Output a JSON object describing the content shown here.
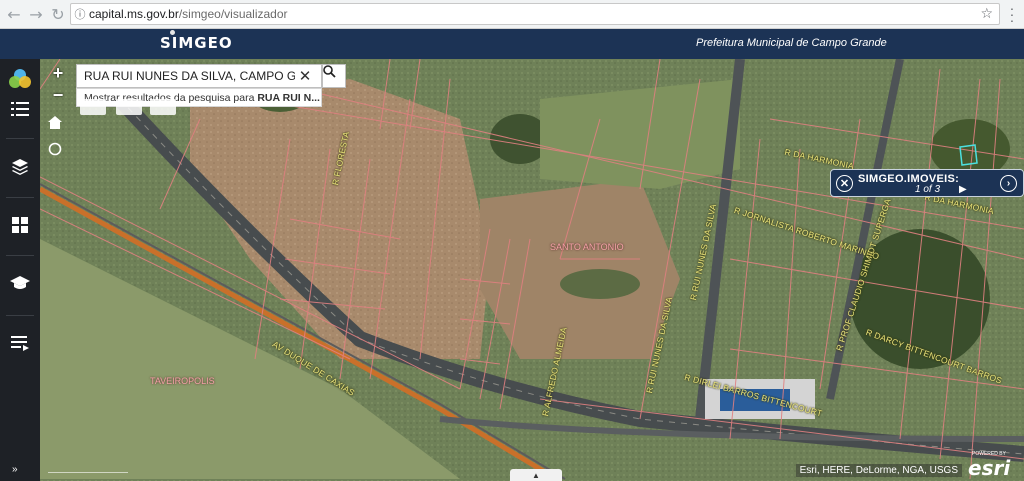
{
  "browser": {
    "url_host": "capital.ms.gov.br",
    "url_path": "/simgeo/visualizador"
  },
  "header": {
    "brand": "SIMGEO",
    "organization": "Prefeitura Municipal de Campo Grande"
  },
  "sidebar": {
    "items": [
      {
        "name": "apps-logo"
      },
      {
        "name": "legend-list"
      },
      {
        "name": "layers"
      },
      {
        "name": "widgets-grid"
      },
      {
        "name": "print"
      },
      {
        "name": "notes"
      }
    ]
  },
  "map_controls": {
    "zoom_in": "+",
    "zoom_out": "−"
  },
  "search": {
    "value": "RUA RUI NUNES DA SILVA, CAMPO GRANDE",
    "suggestion_prefix": "Mostrar resultados da pesquisa para ",
    "suggestion_term": "RUA RUI N..."
  },
  "popup": {
    "title": "SIMGEO.IMOVEIS:",
    "count": "1 of 3"
  },
  "map_labels": {
    "r_floresta": "R FLORESTA",
    "r_da_harmonia": "R DA HARMONIA",
    "r_da_harmonia_2": "R DA HARMONIA",
    "r_jornalista": "R JORNALISTA ROBERTO MARINHO",
    "r_rui_nunes_1": "R RUI NUNES DA SILVA",
    "r_rui_nunes_2": "R RUI NUNES DA SILVA",
    "r_claudio": "R PROF CLAUDIO SHIMIDT SUPERGA",
    "r_darcy": "R DARCY BITTENCOURT BARROS",
    "r_dirlei": "R DIRLEI BARROS BITTENCOURT",
    "r_alfredo": "R ALFREDO ALMEIDA",
    "av_duque": "AV DUQUE DE CAXIAS",
    "santo_antonio": "SANTO ANTONIO",
    "taveiropolis": "TAVEIROPOLIS"
  },
  "attribution": "Esri, HERE, DeLorme, NGA, USGS",
  "esri": {
    "powered": "POWERED BY",
    "logo": "esri"
  }
}
